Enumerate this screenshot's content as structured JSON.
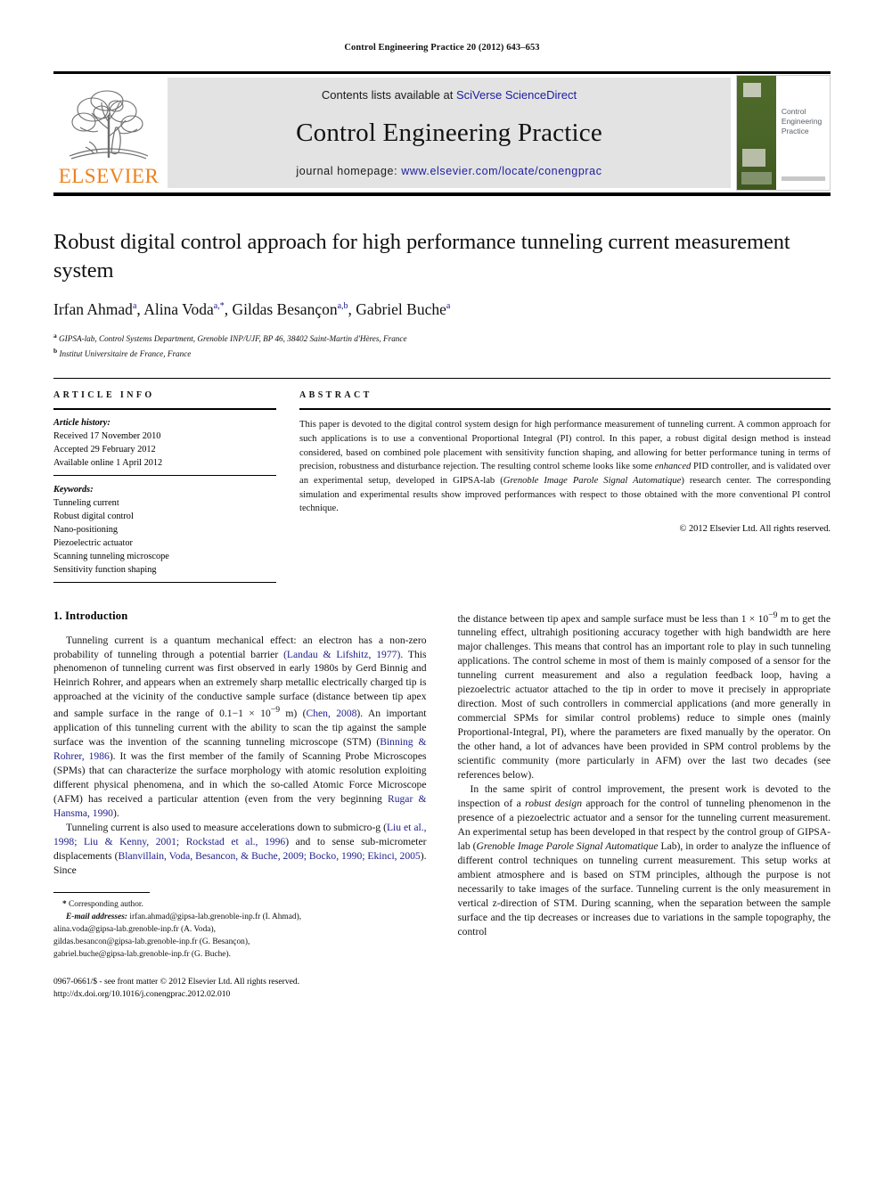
{
  "running_head": "Control Engineering Practice 20 (2012) 643–653",
  "journal_header": {
    "contents_prefix": "Contents lists available at ",
    "contents_link": "SciVerse ScienceDirect",
    "journal_title": "Control Engineering Practice",
    "homepage_prefix": "journal homepage: ",
    "homepage_link": "www.elsevier.com/locate/conengprac",
    "publisher_logo_text": "ELSEVIER",
    "publisher_logo_color": "#ef7f1a",
    "link_color": "#1c1ca0",
    "band_color": "#e3e3e3",
    "cover_title": "Control\nEngineering\nPractice",
    "cover_spine_color": "#4a6528"
  },
  "article": {
    "title": "Robust digital control approach for high performance tunneling current measurement system",
    "authors": "Irfan Ahmad a, Alina Voda a,*, Gildas Besançon a,b, Gabriel Buche a",
    "authors_parts": [
      {
        "name": "Irfan Ahmad",
        "sup": "a"
      },
      {
        "name": "Alina Voda",
        "sup": "a,*"
      },
      {
        "name": "Gildas Besançon",
        "sup": "a,b"
      },
      {
        "name": "Gabriel Buche",
        "sup": "a"
      }
    ],
    "affiliations": [
      {
        "marker": "a",
        "text": "GIPSA-lab, Control Systems Department, Grenoble INP/UJF, BP 46, 38402 Saint-Martin d'Hères, France"
      },
      {
        "marker": "b",
        "text": "Institut Universitaire de France, France"
      }
    ]
  },
  "article_info": {
    "heading": "ARTICLE INFO",
    "history_label": "Article history:",
    "history": [
      "Received 17 November 2010",
      "Accepted 29 February 2012",
      "Available online 1 April 2012"
    ],
    "keywords_label": "Keywords:",
    "keywords": [
      "Tunneling current",
      "Robust digital control",
      "Nano-positioning",
      "Piezoelectric actuator",
      "Scanning tunneling microscope",
      "Sensitivity function shaping"
    ]
  },
  "abstract": {
    "heading": "ABSTRACT",
    "p1_a": "This paper is devoted to the digital control system design for high performance measurement of tunneling current. A common approach for such applications is to use a conventional Proportional Integral (PI) control. In this paper, a robust digital design method is instead considered, based on combined pole placement with sensitivity function shaping, and allowing for better performance tuning in terms of precision, robustness and disturbance rejection. The resulting control scheme looks like some ",
    "p1_em1": "enhanced",
    "p1_b": " PID controller, and is validated over an experimental setup, developed in GIPSA-lab (",
    "p1_em2": "Grenoble Image Parole Signal Automatique",
    "p1_c": ") research center. The corresponding simulation and experimental results show improved performances with respect to those obtained with the more conventional PI control technique.",
    "copyright": "© 2012 Elsevier Ltd. All rights reserved."
  },
  "body": {
    "section_heading": "1.  Introduction",
    "left_paragraphs": [
      {
        "segments": [
          {
            "t": "Tunneling current is a quantum mechanical effect: an electron has a non-zero probability of tunneling through a potential barrier ",
            "s": "plain"
          },
          {
            "t": "(Landau & Lifshitz, 1977)",
            "s": "cite"
          },
          {
            "t": ". This phenomenon of tunneling current was first observed in early 1980s by Gerd Binnig and Heinrich Rohrer, and appears when an extremely sharp metallic electrically charged tip is approached at the vicinity of the conductive sample surface (distance between tip apex and sample surface in the range of 0.1−1 × 10",
            "s": "plain"
          },
          {
            "t": "−9",
            "s": "sup"
          },
          {
            "t": " m) (",
            "s": "plain"
          },
          {
            "t": "Chen, 2008",
            "s": "cite"
          },
          {
            "t": "). An important application of this tunneling current with the ability to scan the tip against the sample surface was the invention of the scanning tunneling microscope (STM) (",
            "s": "plain"
          },
          {
            "t": "Binning & Rohrer, 1986",
            "s": "cite"
          },
          {
            "t": "). It was the first member of the family of Scanning Probe Microscopes (SPMs) that can characterize the surface morphology with atomic resolution exploiting different physical phenomena, and in which the so-called Atomic Force Microscope (AFM) has received a particular attention (even from the very beginning ",
            "s": "plain"
          },
          {
            "t": "Rugar & Hansma, 1990",
            "s": "cite"
          },
          {
            "t": ").",
            "s": "plain"
          }
        ]
      },
      {
        "segments": [
          {
            "t": "Tunneling current is also used to measure accelerations down to submicro-g (",
            "s": "plain"
          },
          {
            "t": "Liu et al., 1998; Liu & Kenny, 2001; Rockstad et al., 1996",
            "s": "cite"
          },
          {
            "t": ") and to sense sub-micrometer displacements (",
            "s": "plain"
          },
          {
            "t": "Blanvillain, Voda, Besancon, & Buche, 2009; Bocko, 1990; Ekinci, 2005",
            "s": "cite"
          },
          {
            "t": "). Since",
            "s": "plain"
          }
        ]
      }
    ],
    "right_paragraphs": [
      {
        "segments": [
          {
            "t": "the distance between tip apex and sample surface must be less than 1 × 10",
            "s": "plain"
          },
          {
            "t": "−9",
            "s": "sup"
          },
          {
            "t": " m to get the tunneling effect, ultrahigh positioning accuracy together with high bandwidth are here major challenges. This means that control has an important role to play in such tunneling applications. The control scheme in most of them is mainly composed of a sensor for the tunneling current measurement and also a regulation feedback loop, having a piezoelectric actuator attached to the tip in order to move it precisely in appropriate direction. Most of such controllers in commercial applications (and more generally in commercial SPMs for similar control problems) reduce to simple ones (mainly Proportional-Integral, PI), where the parameters are fixed manually by the operator. On the other hand, a lot of advances have been provided in SPM control problems by the scientific community (more particularly in AFM) over the last two decades (see references below).",
            "s": "plain"
          }
        ]
      },
      {
        "segments": [
          {
            "t": "In the same spirit of control improvement, the present work is devoted to the inspection of a ",
            "s": "plain"
          },
          {
            "t": "robust design",
            "s": "ital"
          },
          {
            "t": " approach for the control of tunneling phenomenon in the presence of a piezoelectric actuator and a sensor for the tunneling current measurement. An experimental setup has been developed in that respect by the control group of GIPSA-lab (",
            "s": "plain"
          },
          {
            "t": "Grenoble Image Parole Signal Automatique",
            "s": "ital"
          },
          {
            "t": " Lab), in order to analyze the influence of different control techniques on tunneling current measurement. This setup works at ambient atmosphere and is based on STM principles, although the purpose is not necessarily to take images of the surface. Tunneling current is the only measurement in vertical z-direction of STM. During scanning, when the separation between the sample surface and the tip decreases or increases due to variations in the sample topography, the control",
            "s": "plain"
          }
        ]
      }
    ]
  },
  "footnote": {
    "corresponding": "Corresponding author.",
    "email_label": "E-mail addresses:",
    "emails": [
      "irfan.ahmad@gipsa-lab.grenoble-inp.fr (I. Ahmad),",
      "alina.voda@gipsa-lab.grenoble-inp.fr (A. Voda),",
      "gildas.besancon@gipsa-lab.grenoble-inp.fr (G. Besançon),",
      "gabriel.buche@gipsa-lab.grenoble-inp.fr (G. Buche)."
    ]
  },
  "imprint": {
    "line1": "0967-0661/$ - see front matter © 2012 Elsevier Ltd. All rights reserved.",
    "line2": "http://dx.doi.org/10.1016/j.conengprac.2012.02.010"
  }
}
